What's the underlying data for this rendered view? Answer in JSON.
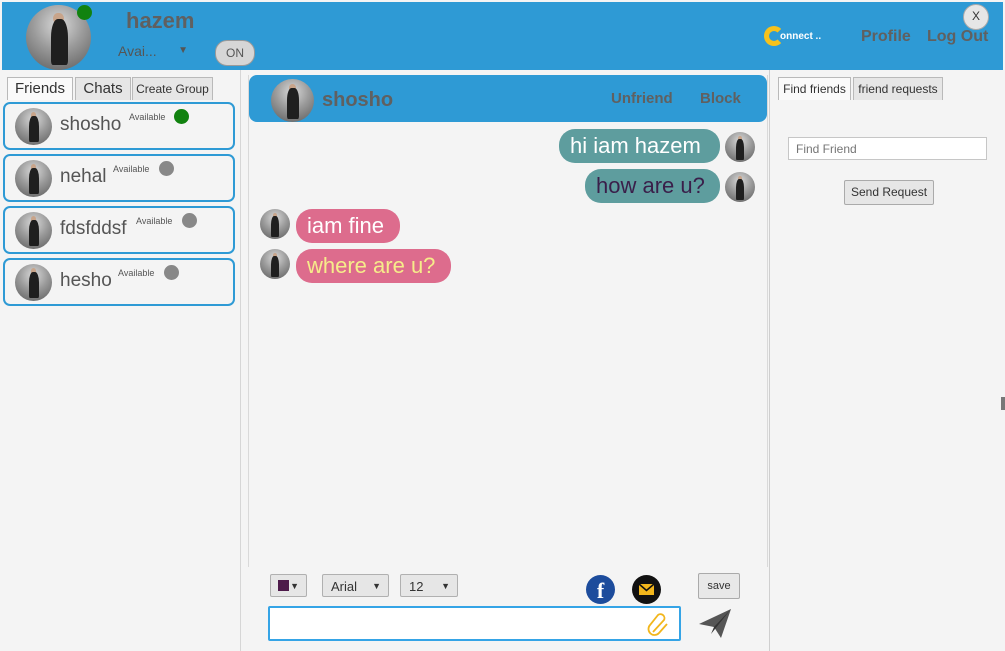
{
  "colors": {
    "header_bg": "#2e9ad5",
    "online": "#11820f",
    "offline": "#888888",
    "out_bubble": "#5e9d9e",
    "in_bubble": "#dd6c8d"
  },
  "header": {
    "user_name": "hazem",
    "status_value": "Avai...",
    "toggle_label": "ON",
    "logo_text": "onnect ..",
    "profile_label": "Profile",
    "logout_label": "Log Out",
    "close_label": "X"
  },
  "left_tabs": [
    "Friends",
    "Chats",
    "Create Group"
  ],
  "friends": [
    {
      "name": "shosho",
      "status": "Available",
      "online": true
    },
    {
      "name": "nehal",
      "status": "Available",
      "online": false
    },
    {
      "name": "fdsfddsf",
      "status": "Available",
      "online": false
    },
    {
      "name": "hesho",
      "status": "Available",
      "online": false
    }
  ],
  "chat": {
    "contact_name": "shosho",
    "unfriend_label": "Unfriend",
    "block_label": "Block",
    "messages": [
      {
        "text": "hi iam hazem",
        "direction": "out",
        "text_color": "#ffffff"
      },
      {
        "text": "how are u?",
        "direction": "out",
        "text_color": "#3a1f4a"
      },
      {
        "text": "iam fine",
        "direction": "in",
        "text_color": "#ffffff"
      },
      {
        "text": "where are u?",
        "direction": "in",
        "text_color": "#f6ec8a"
      }
    ]
  },
  "toolbar": {
    "text_color": "#4d1a4a",
    "font_family": "Arial",
    "font_size": "12",
    "save_label": "save",
    "input_value": ""
  },
  "right": {
    "tabs": [
      "Find friends",
      "friend requests"
    ],
    "find_placeholder": "Find Friend",
    "send_request_label": "Send Request"
  }
}
